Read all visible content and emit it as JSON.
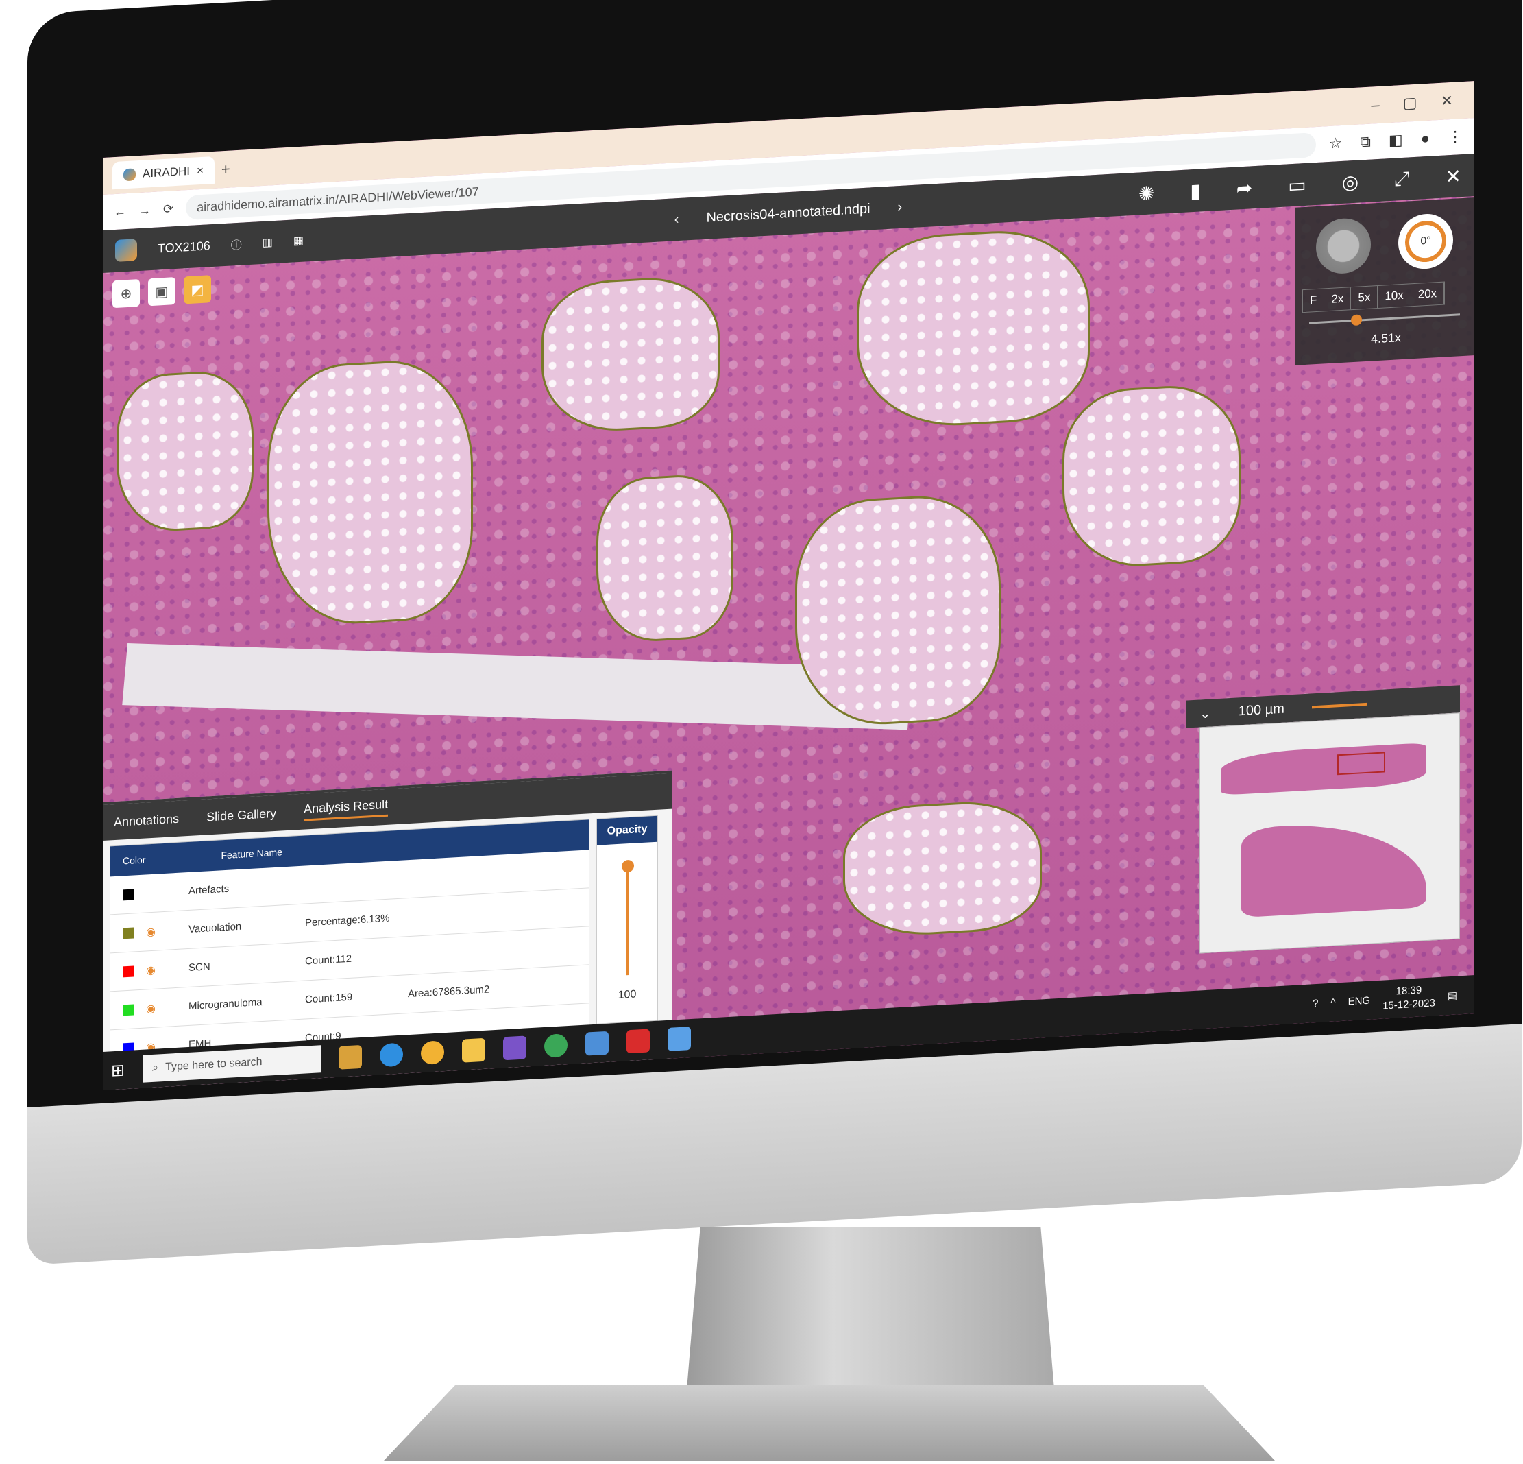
{
  "browser": {
    "tab_title": "AIRADHI",
    "new_tab": "+",
    "tab_close": "×",
    "url": "airadhidemo.airamatrix.in/AIRADHI/WebViewer/107",
    "window_controls": [
      "–",
      "▢",
      "✕"
    ]
  },
  "app": {
    "study_id": "TOX2106",
    "slide_name": "Necrosis04-annotated.ndpi",
    "prev_arrow": "‹",
    "next_arrow": "›",
    "toolbar_icons": [
      "aperture-icon",
      "bar-chart-icon",
      "share-icon",
      "comment-icon",
      "focus-icon",
      "expand-icon",
      "close-icon"
    ]
  },
  "zoom": {
    "rotation": "0°",
    "steps": [
      "F",
      "2x",
      "5x",
      "10x",
      "20x"
    ],
    "value": "4.51x",
    "level": 0.3
  },
  "scale_bar": {
    "label": "100 µm"
  },
  "analysis_panel": {
    "tabs": [
      "Annotations",
      "Slide Gallery",
      "Analysis Result"
    ],
    "selected_tab": "Analysis Result",
    "columns": [
      "Color",
      "Feature Name"
    ],
    "rows": [
      {
        "color": "#000000",
        "name": "Artefacts",
        "metric": "",
        "extra": ""
      },
      {
        "color": "#808020",
        "name": "Vacuolation",
        "metric": "Percentage:6.13%",
        "extra": ""
      },
      {
        "color": "#ff0000",
        "name": "SCN",
        "metric": "Count:112",
        "extra": ""
      },
      {
        "color": "#22dd22",
        "name": "Microgranuloma",
        "metric": "Count:159",
        "extra": "Area:67865.3um2"
      },
      {
        "color": "#0000ff",
        "name": "EMH",
        "metric": "Count:9",
        "extra": ""
      }
    ],
    "opacity_label": "Opacity",
    "opacity_value": "100"
  },
  "taskbar": {
    "search_placeholder": "Type here to search",
    "language": "ENG",
    "time": "18:39",
    "date": "15-12-2023"
  },
  "colors": {
    "accent": "#e6882e",
    "header": "#1e3f78",
    "tissue": "#c2689f"
  }
}
